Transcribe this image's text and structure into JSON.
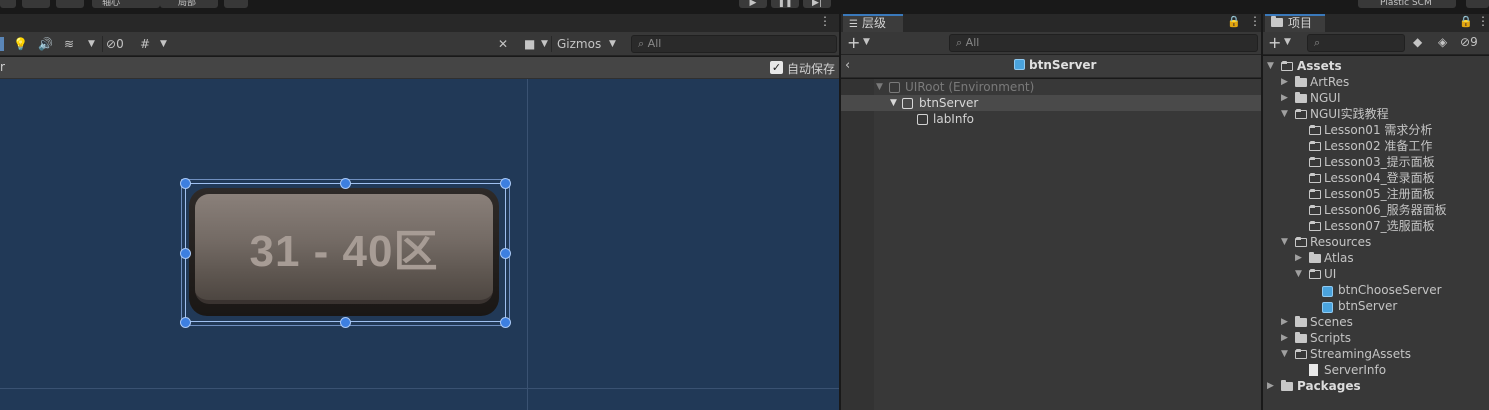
{
  "toolbar_top": {
    "pivot_label": "轴心",
    "local_label": "局部"
  },
  "scene": {
    "title_fragment": "r",
    "gizmos_label": "Gizmos",
    "search_placeholder": "All",
    "hidden_count": "0",
    "autosave_label": "自动保存",
    "button_text": "31 - 40区"
  },
  "hierarchy": {
    "tab_label": "层级",
    "search_placeholder": "All",
    "context_title": "btnServer",
    "rows": [
      {
        "label": "UIRoot (Environment)"
      },
      {
        "label": "btnServer"
      },
      {
        "label": "labInfo"
      }
    ]
  },
  "project": {
    "tab_label": "项目",
    "hidden_count": "9",
    "tree": [
      {
        "label": "Assets"
      },
      {
        "label": "ArtRes"
      },
      {
        "label": "NGUI"
      },
      {
        "label": "NGUI实践教程"
      },
      {
        "label": "Lesson01 需求分析"
      },
      {
        "label": "Lesson02 准备工作"
      },
      {
        "label": "Lesson03_提示面板"
      },
      {
        "label": "Lesson04_登录面板"
      },
      {
        "label": "Lesson05_注册面板"
      },
      {
        "label": "Lesson06_服务器面板"
      },
      {
        "label": "Lesson07_选服面板"
      },
      {
        "label": "Resources"
      },
      {
        "label": "Atlas"
      },
      {
        "label": "UI"
      },
      {
        "label": "btnChooseServer"
      },
      {
        "label": "btnServer"
      },
      {
        "label": "Scenes"
      },
      {
        "label": "Scripts"
      },
      {
        "label": "StreamingAssets"
      },
      {
        "label": "ServerInfo"
      },
      {
        "label": "Packages"
      }
    ]
  },
  "top_right": {
    "plastic_label": "Plastic SCM"
  }
}
